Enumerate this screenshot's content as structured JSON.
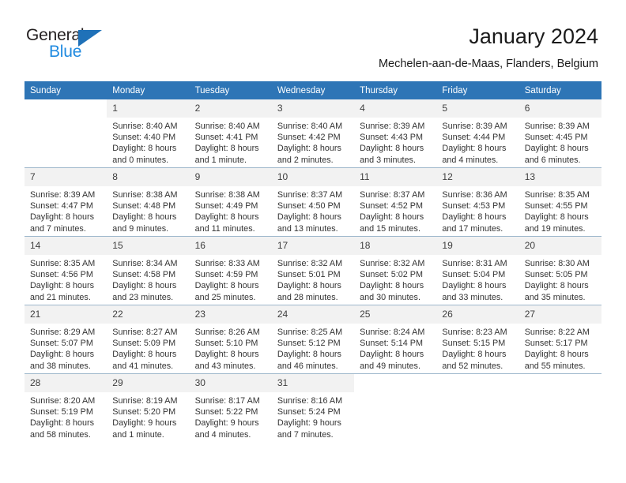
{
  "brand": {
    "name_primary": "General",
    "name_secondary": "Blue",
    "accent_color": "#1f71b8",
    "secondary_color": "#1f8ae0"
  },
  "header": {
    "title": "January 2024",
    "subtitle": "Mechelen-aan-de-Maas, Flanders, Belgium"
  },
  "calendar": {
    "header_bg": "#2e75b6",
    "daynum_bg": "#f2f2f2",
    "weekday_headers": [
      "Sunday",
      "Monday",
      "Tuesday",
      "Wednesday",
      "Thursday",
      "Friday",
      "Saturday"
    ],
    "weeks": [
      [
        {
          "day": "",
          "lines": []
        },
        {
          "day": "1",
          "lines": [
            "Sunrise: 8:40 AM",
            "Sunset: 4:40 PM",
            "Daylight: 8 hours",
            "and 0 minutes."
          ]
        },
        {
          "day": "2",
          "lines": [
            "Sunrise: 8:40 AM",
            "Sunset: 4:41 PM",
            "Daylight: 8 hours",
            "and 1 minute."
          ]
        },
        {
          "day": "3",
          "lines": [
            "Sunrise: 8:40 AM",
            "Sunset: 4:42 PM",
            "Daylight: 8 hours",
            "and 2 minutes."
          ]
        },
        {
          "day": "4",
          "lines": [
            "Sunrise: 8:39 AM",
            "Sunset: 4:43 PM",
            "Daylight: 8 hours",
            "and 3 minutes."
          ]
        },
        {
          "day": "5",
          "lines": [
            "Sunrise: 8:39 AM",
            "Sunset: 4:44 PM",
            "Daylight: 8 hours",
            "and 4 minutes."
          ]
        },
        {
          "day": "6",
          "lines": [
            "Sunrise: 8:39 AM",
            "Sunset: 4:45 PM",
            "Daylight: 8 hours",
            "and 6 minutes."
          ]
        }
      ],
      [
        {
          "day": "7",
          "lines": [
            "Sunrise: 8:39 AM",
            "Sunset: 4:47 PM",
            "Daylight: 8 hours",
            "and 7 minutes."
          ]
        },
        {
          "day": "8",
          "lines": [
            "Sunrise: 8:38 AM",
            "Sunset: 4:48 PM",
            "Daylight: 8 hours",
            "and 9 minutes."
          ]
        },
        {
          "day": "9",
          "lines": [
            "Sunrise: 8:38 AM",
            "Sunset: 4:49 PM",
            "Daylight: 8 hours",
            "and 11 minutes."
          ]
        },
        {
          "day": "10",
          "lines": [
            "Sunrise: 8:37 AM",
            "Sunset: 4:50 PM",
            "Daylight: 8 hours",
            "and 13 minutes."
          ]
        },
        {
          "day": "11",
          "lines": [
            "Sunrise: 8:37 AM",
            "Sunset: 4:52 PM",
            "Daylight: 8 hours",
            "and 15 minutes."
          ]
        },
        {
          "day": "12",
          "lines": [
            "Sunrise: 8:36 AM",
            "Sunset: 4:53 PM",
            "Daylight: 8 hours",
            "and 17 minutes."
          ]
        },
        {
          "day": "13",
          "lines": [
            "Sunrise: 8:35 AM",
            "Sunset: 4:55 PM",
            "Daylight: 8 hours",
            "and 19 minutes."
          ]
        }
      ],
      [
        {
          "day": "14",
          "lines": [
            "Sunrise: 8:35 AM",
            "Sunset: 4:56 PM",
            "Daylight: 8 hours",
            "and 21 minutes."
          ]
        },
        {
          "day": "15",
          "lines": [
            "Sunrise: 8:34 AM",
            "Sunset: 4:58 PM",
            "Daylight: 8 hours",
            "and 23 minutes."
          ]
        },
        {
          "day": "16",
          "lines": [
            "Sunrise: 8:33 AM",
            "Sunset: 4:59 PM",
            "Daylight: 8 hours",
            "and 25 minutes."
          ]
        },
        {
          "day": "17",
          "lines": [
            "Sunrise: 8:32 AM",
            "Sunset: 5:01 PM",
            "Daylight: 8 hours",
            "and 28 minutes."
          ]
        },
        {
          "day": "18",
          "lines": [
            "Sunrise: 8:32 AM",
            "Sunset: 5:02 PM",
            "Daylight: 8 hours",
            "and 30 minutes."
          ]
        },
        {
          "day": "19",
          "lines": [
            "Sunrise: 8:31 AM",
            "Sunset: 5:04 PM",
            "Daylight: 8 hours",
            "and 33 minutes."
          ]
        },
        {
          "day": "20",
          "lines": [
            "Sunrise: 8:30 AM",
            "Sunset: 5:05 PM",
            "Daylight: 8 hours",
            "and 35 minutes."
          ]
        }
      ],
      [
        {
          "day": "21",
          "lines": [
            "Sunrise: 8:29 AM",
            "Sunset: 5:07 PM",
            "Daylight: 8 hours",
            "and 38 minutes."
          ]
        },
        {
          "day": "22",
          "lines": [
            "Sunrise: 8:27 AM",
            "Sunset: 5:09 PM",
            "Daylight: 8 hours",
            "and 41 minutes."
          ]
        },
        {
          "day": "23",
          "lines": [
            "Sunrise: 8:26 AM",
            "Sunset: 5:10 PM",
            "Daylight: 8 hours",
            "and 43 minutes."
          ]
        },
        {
          "day": "24",
          "lines": [
            "Sunrise: 8:25 AM",
            "Sunset: 5:12 PM",
            "Daylight: 8 hours",
            "and 46 minutes."
          ]
        },
        {
          "day": "25",
          "lines": [
            "Sunrise: 8:24 AM",
            "Sunset: 5:14 PM",
            "Daylight: 8 hours",
            "and 49 minutes."
          ]
        },
        {
          "day": "26",
          "lines": [
            "Sunrise: 8:23 AM",
            "Sunset: 5:15 PM",
            "Daylight: 8 hours",
            "and 52 minutes."
          ]
        },
        {
          "day": "27",
          "lines": [
            "Sunrise: 8:22 AM",
            "Sunset: 5:17 PM",
            "Daylight: 8 hours",
            "and 55 minutes."
          ]
        }
      ],
      [
        {
          "day": "28",
          "lines": [
            "Sunrise: 8:20 AM",
            "Sunset: 5:19 PM",
            "Daylight: 8 hours",
            "and 58 minutes."
          ]
        },
        {
          "day": "29",
          "lines": [
            "Sunrise: 8:19 AM",
            "Sunset: 5:20 PM",
            "Daylight: 9 hours",
            "and 1 minute."
          ]
        },
        {
          "day": "30",
          "lines": [
            "Sunrise: 8:17 AM",
            "Sunset: 5:22 PM",
            "Daylight: 9 hours",
            "and 4 minutes."
          ]
        },
        {
          "day": "31",
          "lines": [
            "Sunrise: 8:16 AM",
            "Sunset: 5:24 PM",
            "Daylight: 9 hours",
            "and 7 minutes."
          ]
        },
        {
          "day": "",
          "lines": []
        },
        {
          "day": "",
          "lines": []
        },
        {
          "day": "",
          "lines": []
        }
      ]
    ]
  }
}
